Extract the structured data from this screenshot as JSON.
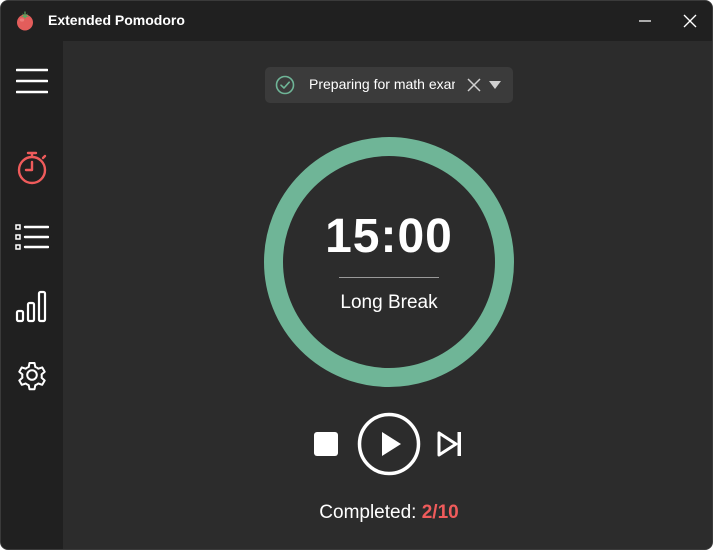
{
  "window": {
    "title": "Extended Pomodoro",
    "icon": "tomato-icon"
  },
  "sidebar": {
    "items": [
      {
        "name": "menu",
        "icon": "hamburger-menu-icon"
      },
      {
        "name": "timer",
        "icon": "timer-icon",
        "active": true
      },
      {
        "name": "tasks",
        "icon": "list-icon"
      },
      {
        "name": "statistics",
        "icon": "bar-chart-icon"
      },
      {
        "name": "settings",
        "icon": "gear-icon"
      }
    ]
  },
  "task": {
    "label": "Preparing for math exam",
    "status_icon": "check-circle-icon"
  },
  "timer": {
    "time": "15:00",
    "mode": "Long Break",
    "progress": 1.0
  },
  "controls": {
    "stop_icon": "stop-icon",
    "play_icon": "play-icon",
    "skip_icon": "skip-next-icon"
  },
  "progress": {
    "label": "Completed:",
    "count": "2/10"
  },
  "colors": {
    "accent_green": "#6fb597",
    "accent_red": "#ef5b5b",
    "background": "#2c2c2c",
    "sidebar": "#202020"
  }
}
